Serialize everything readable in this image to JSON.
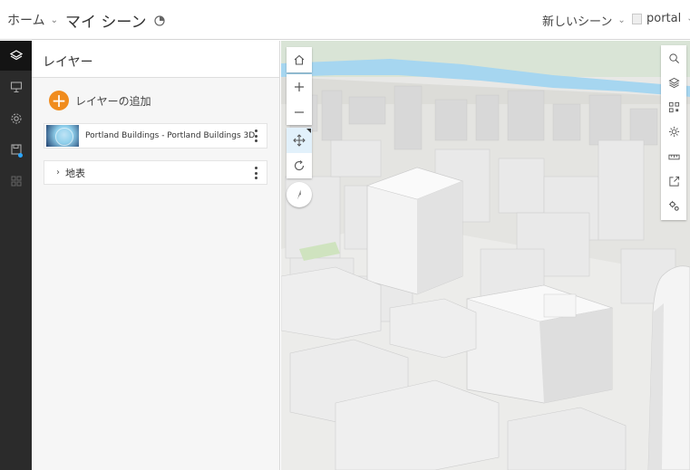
{
  "header": {
    "home_label": "ホーム",
    "scene_title": "マイ シーン",
    "new_scene_label": "新しいシーン",
    "user_label": "portal"
  },
  "rail": {
    "items": [
      {
        "name": "layers",
        "icon": "layers-icon",
        "active": true
      },
      {
        "name": "slides",
        "icon": "presentation-icon",
        "active": false
      },
      {
        "name": "properties",
        "icon": "gear-icon",
        "active": false
      },
      {
        "name": "save",
        "icon": "save-icon",
        "active": false,
        "badge": true
      },
      {
        "name": "share",
        "icon": "grid-icon",
        "active": false
      }
    ]
  },
  "layers_panel": {
    "title": "レイヤー",
    "add_layer_label": "レイヤーの追加",
    "layers": [
      {
        "name": "Portland Buildings - Portland Buildings 3D"
      }
    ],
    "basemap_label": "地表"
  },
  "map_tools": [
    "search-icon",
    "layers-icon",
    "qr-icon",
    "sun-icon",
    "measure-icon",
    "share-icon",
    "settings-icon"
  ],
  "colors": {
    "accent_orange": "#f08c1e",
    "rail_background": "#2b2b2b",
    "notification_dot": "#2aa6ff",
    "river": "#a6d6f0"
  }
}
